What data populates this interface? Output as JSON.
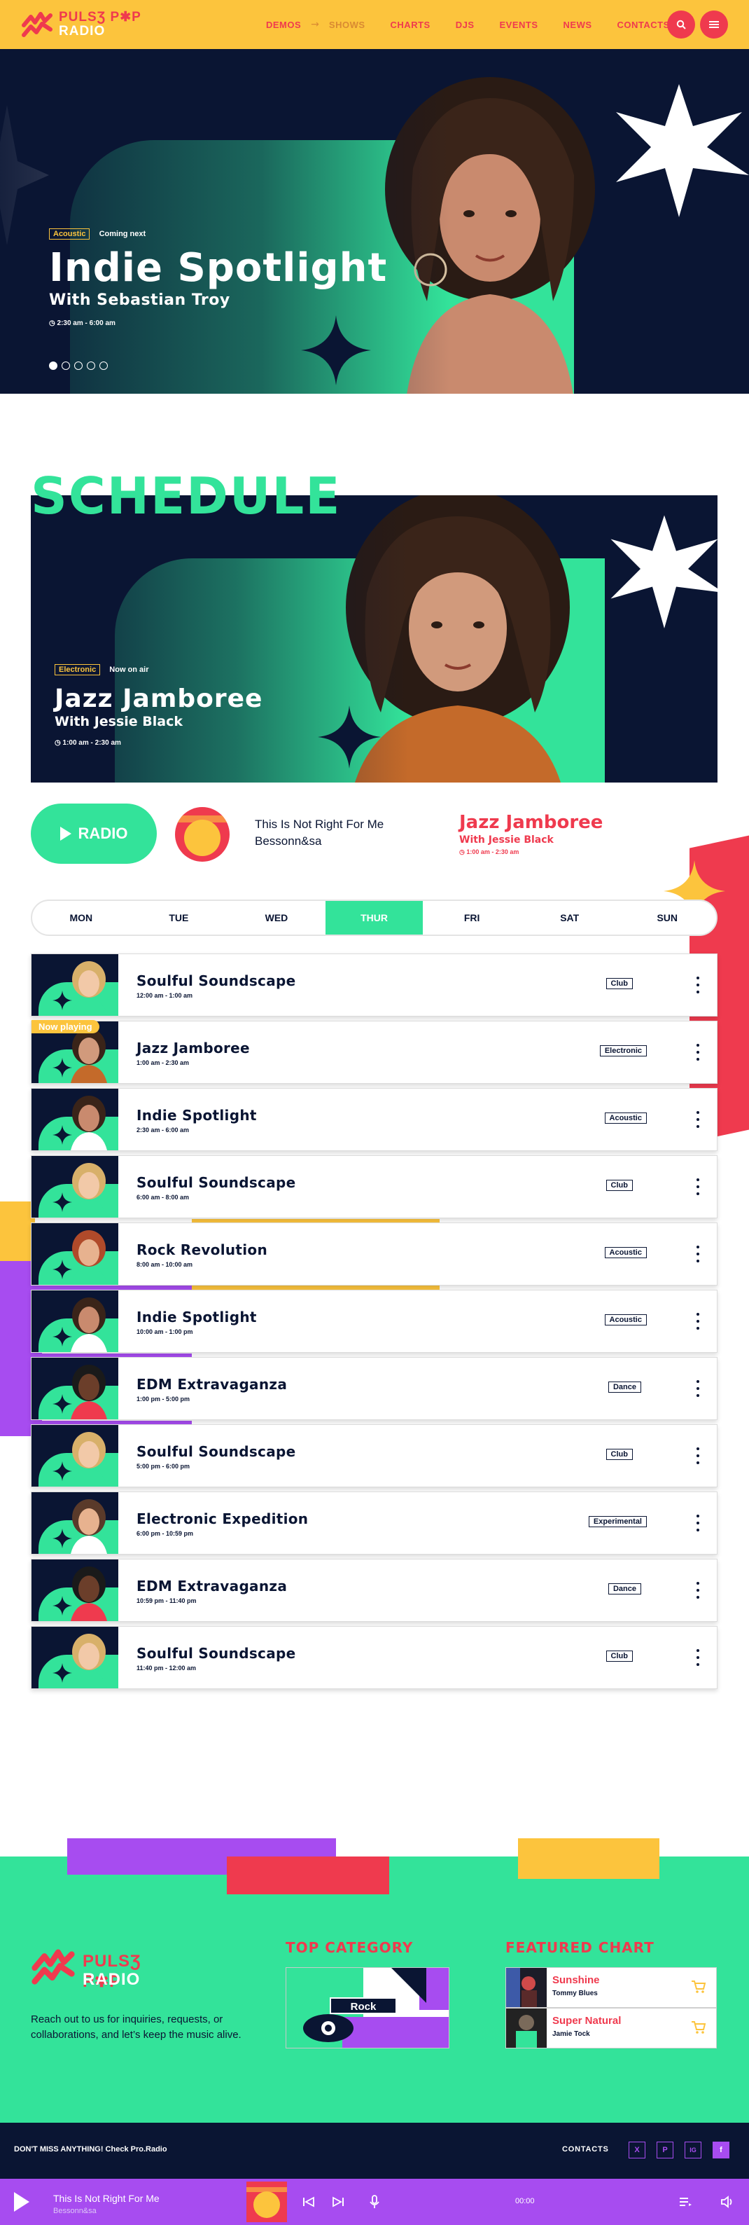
{
  "brand": {
    "line1": "PULSƷ P✱P",
    "line2": "RADIO"
  },
  "nav": {
    "items": [
      "DEMOS",
      "SHOWS",
      "CHARTS",
      "DJS",
      "EVENTS",
      "NEWS",
      "CONTACTS"
    ],
    "active": "SHOWS"
  },
  "icons": {
    "search": "search-icon",
    "menu": "menu-icon"
  },
  "colors": {
    "yellow": "#fcc43d",
    "red": "#ef3a4e",
    "green": "#33e39a",
    "navy": "#0a1533",
    "purple": "#a74cf0"
  },
  "hero": {
    "tag": "Acoustic",
    "status": "Coming next",
    "title": "Indie Spotlight",
    "subtitle": "With Sebastian Troy",
    "time": "2:30 am - 6:00 am",
    "slides": 5,
    "active_slide": 1
  },
  "schedule": {
    "heading": "SCHEDULE",
    "banner": {
      "tag": "Electronic",
      "status": "Now on air",
      "title": "Jazz Jamboree",
      "subtitle": "With Jessie Black",
      "time": "1:00 am - 2:30 am"
    },
    "player": {
      "button_label": "RADIO",
      "track": "This Is Not Right For Me",
      "artist": "Bessonn&sa",
      "show": "Jazz Jamboree",
      "host": "With Jessie Black",
      "time": "1:00 am - 2:30 am"
    },
    "days": [
      "MON",
      "TUE",
      "WED",
      "THUR",
      "FRI",
      "SAT",
      "SUN"
    ],
    "active_day": "THUR",
    "now_playing_label": "Now playing",
    "shows": [
      {
        "title": "Soulful Soundscape",
        "time": "12:00 am - 1:00 am",
        "tag": "Club"
      },
      {
        "title": "Jazz Jamboree",
        "time": "1:00 am - 2:30 am",
        "tag": "Electronic",
        "now": true
      },
      {
        "title": "Indie Spotlight",
        "time": "2:30 am - 6:00 am",
        "tag": "Acoustic"
      },
      {
        "title": "Soulful Soundscape",
        "time": "6:00 am - 8:00 am",
        "tag": "Club"
      },
      {
        "title": "Rock Revolution",
        "time": "8:00 am - 10:00 am",
        "tag": "Acoustic"
      },
      {
        "title": "Indie Spotlight",
        "time": "10:00 am - 1:00 pm",
        "tag": "Acoustic"
      },
      {
        "title": "EDM Extravaganza",
        "time": "1:00 pm - 5:00 pm",
        "tag": "Dance"
      },
      {
        "title": "Soulful Soundscape",
        "time": "5:00 pm - 6:00 pm",
        "tag": "Club"
      },
      {
        "title": "Electronic Expedition",
        "time": "6:00 pm - 10:59 pm",
        "tag": "Experimental"
      },
      {
        "title": "EDM Extravaganza",
        "time": "10:59 pm - 11:40 pm",
        "tag": "Dance"
      },
      {
        "title": "Soulful Soundscape",
        "time": "11:40 pm - 12:00 am",
        "tag": "Club"
      }
    ]
  },
  "footer": {
    "about": "Reach out to us for inquiries, requests, or collaborations, and let’s keep the music alive.",
    "top_category_heading": "TOP CATEGORY",
    "top_category_label": "Rock",
    "featured_heading": "FEATURED CHART",
    "featured": [
      {
        "title": "Sunshine",
        "artist": "Tommy Blues"
      },
      {
        "title": "Super Natural",
        "artist": "Jamie Tock"
      }
    ],
    "bottom_text": "DON'T MISS ANYTHING! Check Pro.Radio",
    "contacts": "CONTACTS",
    "social": [
      "X",
      "P",
      "IG",
      "f"
    ]
  },
  "audio_bar": {
    "track": "This Is Not Right For Me",
    "artist": "Bessonn&sa",
    "time": "00:00"
  }
}
